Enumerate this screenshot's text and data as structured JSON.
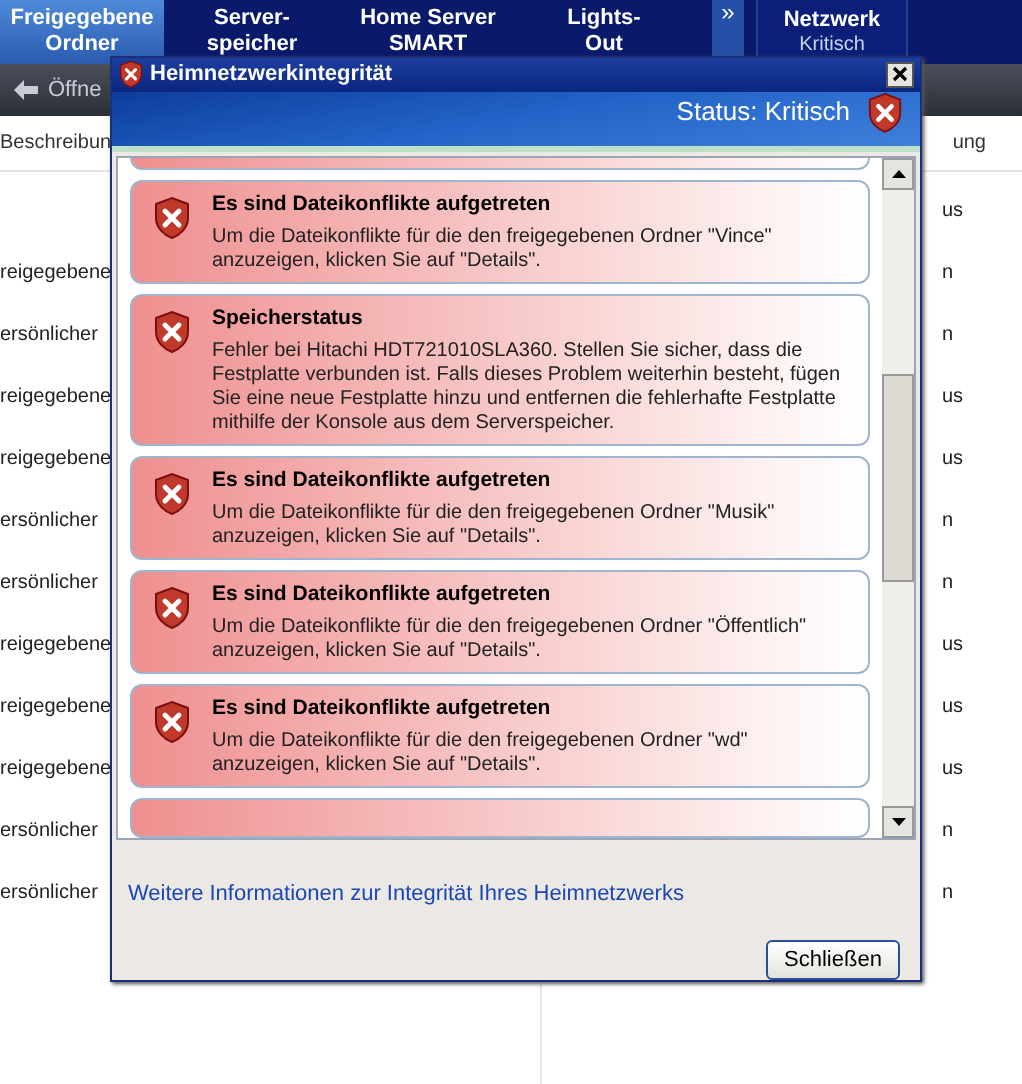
{
  "nav_tabs": [
    {
      "lines": [
        "Freigegebene",
        "Ordner"
      ],
      "selected": true
    },
    {
      "lines": [
        "Server-",
        "speicher"
      ],
      "selected": false
    },
    {
      "lines": [
        "Home Server",
        "SMART"
      ],
      "selected": false
    },
    {
      "lines": [
        "Lights-",
        "Out"
      ],
      "selected": false
    }
  ],
  "more_button": "»",
  "network_tab": {
    "title": "Netzwerk",
    "status": "Kritisch"
  },
  "toolbar": {
    "open_button": "Öffne"
  },
  "list_header": {
    "column_1": "Beschreibun",
    "column_2": "ung"
  },
  "list_rows": [
    {
      "column_1": "",
      "column_2": "us"
    },
    {
      "column_1": "reigegebene",
      "column_2": "n"
    },
    {
      "column_1": "ersönlicher",
      "column_2": "n"
    },
    {
      "column_1": "reigegebene",
      "column_2": "us"
    },
    {
      "column_1": "reigegebene",
      "column_2": "us"
    },
    {
      "column_1": "ersönlicher",
      "column_2": "n"
    },
    {
      "column_1": "ersönlicher",
      "column_2": "n"
    },
    {
      "column_1": "reigegebene",
      "column_2": "us"
    },
    {
      "column_1": "reigegebene",
      "column_2": "us"
    },
    {
      "column_1": "reigegebene",
      "column_2": "us"
    },
    {
      "column_1": "ersönlicher",
      "column_2": "n"
    },
    {
      "column_1": "ersönlicher",
      "column_2": "n"
    }
  ],
  "dialog": {
    "title": "Heimnetzwerkintegrität",
    "status": "Status: Kritisch",
    "alerts": [
      {
        "title": "Es sind Dateikonflikte aufgetreten",
        "body": "Um die Dateikonflikte für die den freigegebenen Ordner \"Vince\" anzuzeigen, klicken Sie auf \"Details\"."
      },
      {
        "title": "Speicherstatus",
        "body": "Fehler bei Hitachi HDT721010SLA360. Stellen Sie sicher, dass die Festplatte verbunden ist. Falls dieses Problem weiterhin besteht, fügen Sie eine neue Festplatte hinzu und entfernen die fehlerhafte Festplatte mithilfe der Konsole aus dem Serverspeicher."
      },
      {
        "title": "Es sind Dateikonflikte aufgetreten",
        "body": "Um die Dateikonflikte für die den freigegebenen Ordner \"Musik\" anzuzeigen, klicken Sie auf \"Details\"."
      },
      {
        "title": "Es sind Dateikonflikte aufgetreten",
        "body": "Um die Dateikonflikte für die den freigegebenen Ordner \"Öffentlich\" anzuzeigen, klicken Sie auf \"Details\"."
      },
      {
        "title": "Es sind Dateikonflikte aufgetreten",
        "body": "Um die Dateikonflikte für die den freigegebenen Ordner \"wd\" anzuzeigen, klicken Sie auf \"Details\"."
      }
    ],
    "link": "Weitere Informationen zur Integrität Ihres Heimnetzwerks",
    "close_button": "Schließen"
  }
}
